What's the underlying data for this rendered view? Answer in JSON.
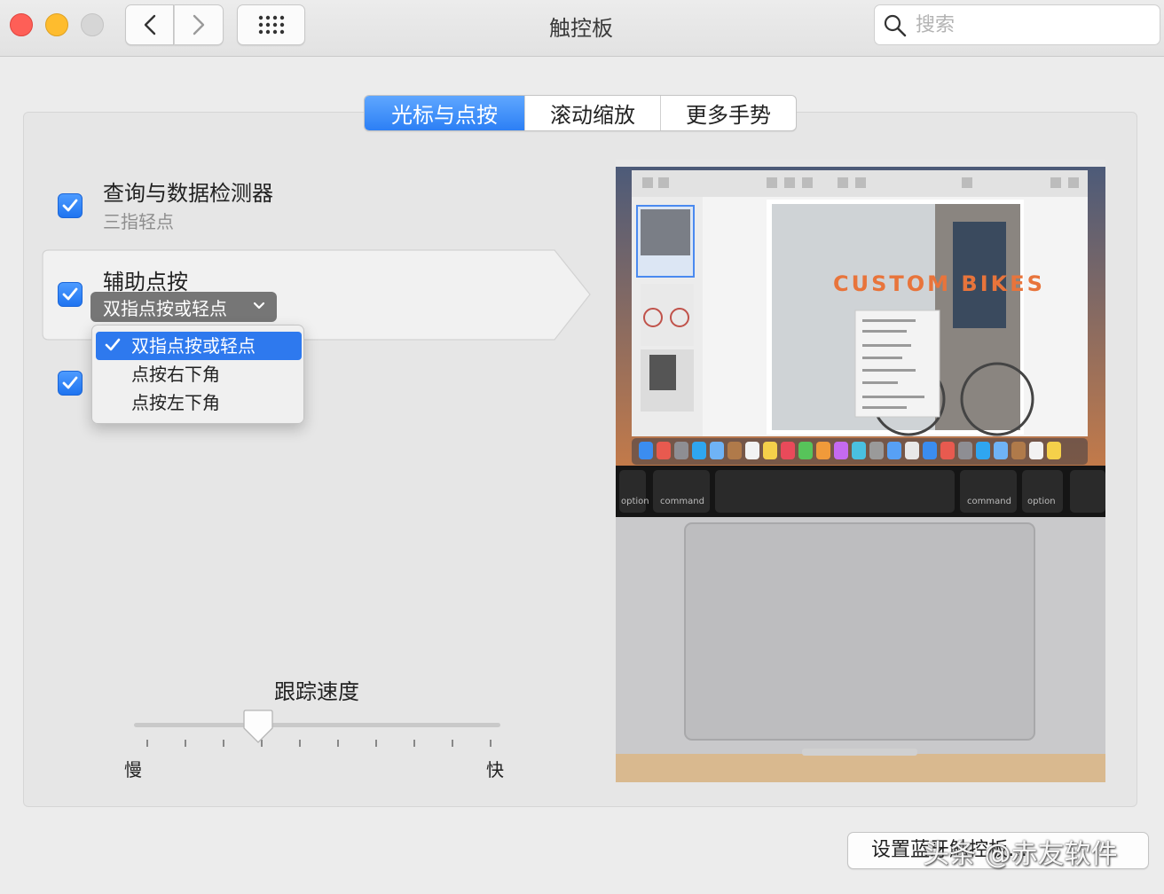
{
  "window": {
    "title": "触控板",
    "search_placeholder": "搜索"
  },
  "tabs": [
    {
      "label": "光标与点按",
      "active": true
    },
    {
      "label": "滚动缩放",
      "active": false
    },
    {
      "label": "更多手势",
      "active": false
    }
  ],
  "options": {
    "lookup": {
      "title": "查询与数据检测器",
      "subtitle": "三指轻点",
      "checked": true
    },
    "secondary_click": {
      "title": "辅助点按",
      "selected": "双指点按或轻点",
      "checked": true
    },
    "tap_to_click": {
      "checked": true
    }
  },
  "dropdown": {
    "items": [
      "双指点按或轻点",
      "点按右下角",
      "点按左下角"
    ],
    "selected_index": 0
  },
  "tracking": {
    "label": "跟踪速度",
    "slow": "慢",
    "fast": "快",
    "value_fraction": 0.34,
    "ticks": 10
  },
  "preview": {
    "headline": "CUSTOM BIKES",
    "key_left": "option",
    "key_cmd": "command",
    "key_cmd2": "command",
    "key_right": "option"
  },
  "footer": {
    "button_label": "设置蓝牙触控板…",
    "watermark": "头条 @赤友软件"
  },
  "colors": {
    "accent": "#2c7ff5",
    "checkbox": "#1f74f0"
  }
}
